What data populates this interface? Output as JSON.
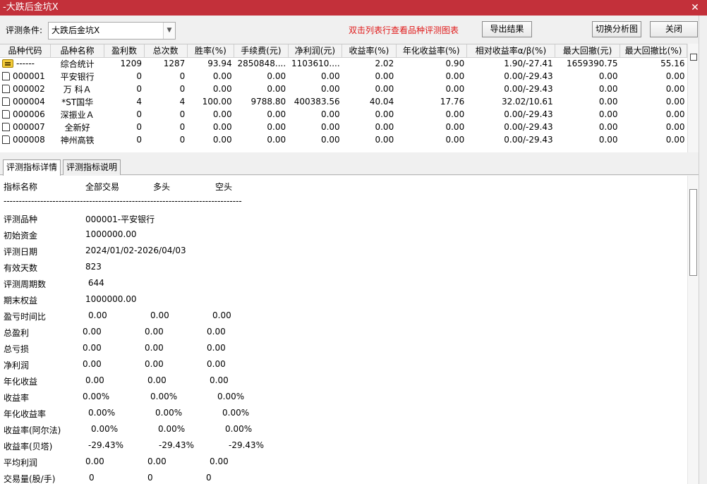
{
  "window": {
    "title": "-大跌后金坑X",
    "close_glyph": "✕"
  },
  "toolbar": {
    "condition_label": "评测条件:",
    "condition_value": "大跌后金坑X",
    "hint": "双击列表行查看品种评测图表",
    "export_label": "导出结果",
    "switch_label": "切换分析图",
    "close_label": "关闭"
  },
  "table": {
    "columns": [
      "品种代码",
      "品种名称",
      "盈利数",
      "总次数",
      "胜率(%)",
      "手续费(元)",
      "净利润(元)",
      "收益率(%)",
      "年化收益率(%)",
      "相对收益率α/β(%)",
      "最大回撤(元)",
      "最大回撤比(%)"
    ],
    "rows": [
      [
        "------",
        "综合统计",
        "1209",
        "1287",
        "93.94",
        "2850848....",
        "1103610....",
        "2.02",
        "0.90",
        "1.90/-27.41",
        "1659390.75",
        "55.16"
      ],
      [
        "000001",
        "平安银行",
        "0",
        "0",
        "0.00",
        "0.00",
        "0.00",
        "0.00",
        "0.00",
        "0.00/-29.43",
        "0.00",
        "0.00"
      ],
      [
        "000002",
        "万 科Ａ",
        "0",
        "0",
        "0.00",
        "0.00",
        "0.00",
        "0.00",
        "0.00",
        "0.00/-29.43",
        "0.00",
        "0.00"
      ],
      [
        "000004",
        "*ST国华",
        "4",
        "4",
        "100.00",
        "9788.80",
        "400383.56",
        "40.04",
        "17.76",
        "32.02/10.61",
        "0.00",
        "0.00"
      ],
      [
        "000006",
        "深振业Ａ",
        "0",
        "0",
        "0.00",
        "0.00",
        "0.00",
        "0.00",
        "0.00",
        "0.00/-29.43",
        "0.00",
        "0.00"
      ],
      [
        "000007",
        "全新好",
        "0",
        "0",
        "0.00",
        "0.00",
        "0.00",
        "0.00",
        "0.00",
        "0.00/-29.43",
        "0.00",
        "0.00"
      ],
      [
        "000008",
        "神州高铁",
        "0",
        "0",
        "0.00",
        "0.00",
        "0.00",
        "0.00",
        "0.00",
        "0.00/-29.43",
        "0.00",
        "0.00"
      ]
    ]
  },
  "tabs": {
    "detail": "评测指标详情",
    "explain": "评测指标说明"
  },
  "detail": {
    "header": [
      "指标名称",
      "全部交易",
      "多头",
      "空头"
    ],
    "separator": "------------------------------------------------------------------------------",
    "info": [
      [
        "评测品种",
        "000001-平安银行"
      ],
      [
        "初始资金",
        "1000000.00"
      ],
      [
        "评测日期",
        "2024/01/02-2026/04/03"
      ],
      [
        "有效天数",
        "823"
      ],
      [
        "评测周期数",
        " 644"
      ],
      [
        "期末权益",
        "1000000.00"
      ]
    ],
    "metrics": [
      [
        "盈亏时间比",
        "0.00",
        "0.00",
        "0.00"
      ],
      [
        "总盈利",
        "0.00",
        "0.00",
        "0.00"
      ],
      [
        "总亏损",
        "0.00",
        "0.00",
        "0.00"
      ],
      [
        "净利润",
        "0.00",
        "0.00",
        "0.00"
      ],
      [
        "年化收益",
        "0.00",
        "0.00",
        "0.00"
      ],
      [
        "收益率",
        "0.00%",
        "0.00%",
        "0.00%"
      ],
      [
        "年化收益率",
        "0.00%",
        "0.00%",
        "0.00%"
      ],
      [
        "收益率(阿尔法)",
        "0.00%",
        "0.00%",
        "0.00%"
      ],
      [
        "收益率(贝塔)",
        "-29.43%",
        "-29.43%",
        "-29.43%"
      ],
      [
        "平均利润",
        "0.00",
        "0.00",
        "0.00"
      ],
      [
        "交易量(股/手)",
        "0",
        "0",
        "0"
      ]
    ]
  },
  "colors": {
    "titlebar": "#c3303a",
    "hint": "#e01b1b"
  }
}
